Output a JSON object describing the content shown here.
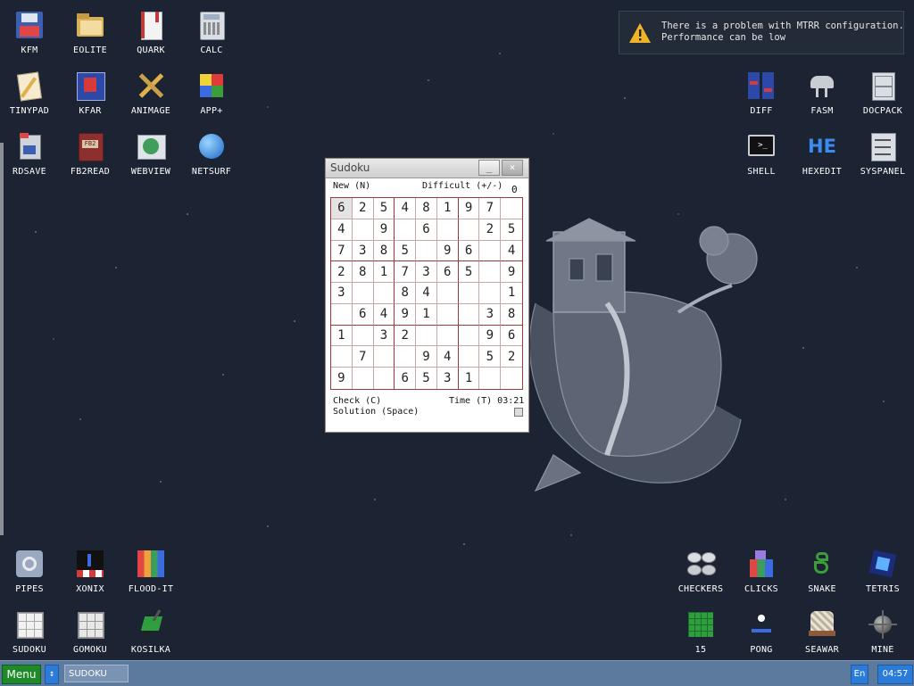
{
  "desktop": {
    "background_color": "#1c2433",
    "icons": [
      {
        "id": "kfm",
        "label": "KFM",
        "icon": "floppy-disk-icon"
      },
      {
        "id": "eolite",
        "label": "EOLITE",
        "icon": "folder-icon"
      },
      {
        "id": "quark",
        "label": "QUARK",
        "icon": "notebook-icon"
      },
      {
        "id": "calc",
        "label": "CALC",
        "icon": "calculator-icon"
      },
      {
        "id": "tinypad",
        "label": "TINYPAD",
        "icon": "notepad-icon"
      },
      {
        "id": "kfar",
        "label": "KFAR",
        "icon": "kfar-icon"
      },
      {
        "id": "animage",
        "label": "ANIMAGE",
        "icon": "pencil-ruler-icon"
      },
      {
        "id": "app-plus",
        "label": "APP+",
        "icon": "rubik-cube-icon"
      },
      {
        "id": "rdsave",
        "label": "RDSAVE",
        "icon": "rdsave-icon"
      },
      {
        "id": "fb2read",
        "label": "FB2READ",
        "icon": "book-icon"
      },
      {
        "id": "webview",
        "label": "WEBVIEW",
        "icon": "webview-icon"
      },
      {
        "id": "netsurf",
        "label": "NETSURF",
        "icon": "globe-icon"
      },
      {
        "id": "diff",
        "label": "DIFF",
        "icon": "diff-icon"
      },
      {
        "id": "fasm",
        "label": "FASM",
        "icon": "fasm-icon"
      },
      {
        "id": "docpack",
        "label": "DOCPACK",
        "icon": "cabinet-icon"
      },
      {
        "id": "shell",
        "label": "SHELL",
        "icon": "terminal-icon"
      },
      {
        "id": "hexedit",
        "label": "HEXEDIT",
        "icon": "hexedit-icon"
      },
      {
        "id": "syspanel",
        "label": "SYSPANEL",
        "icon": "sliders-icon"
      },
      {
        "id": "pipes",
        "label": "PIPES",
        "icon": "pipes-icon"
      },
      {
        "id": "xonix",
        "label": "XONIX",
        "icon": "xonix-icon"
      },
      {
        "id": "flood-it",
        "label": "FLOOD-IT",
        "icon": "colored-grid-icon"
      },
      {
        "id": "sudoku",
        "label": "SUDOKU",
        "icon": "sudoku-icon"
      },
      {
        "id": "gomoku",
        "label": "GOMOKU",
        "icon": "gomoku-icon"
      },
      {
        "id": "kosilka",
        "label": "KOSILKA",
        "icon": "lawnmower-icon"
      },
      {
        "id": "checkers",
        "label": "CHECKERS",
        "icon": "checkers-icon"
      },
      {
        "id": "clicks",
        "label": "CLICKS",
        "icon": "blocks-icon"
      },
      {
        "id": "snake",
        "label": "SNAKE",
        "icon": "snake-icon"
      },
      {
        "id": "tetris",
        "label": "TETRIS",
        "icon": "tetris-icon"
      },
      {
        "id": "fifteen",
        "label": "15",
        "icon": "fifteen-icon"
      },
      {
        "id": "pong",
        "label": "PONG",
        "icon": "pong-icon"
      },
      {
        "id": "seawar",
        "label": "SEAWAR",
        "icon": "ship-icon"
      },
      {
        "id": "mine",
        "label": "MINE",
        "icon": "mine-icon"
      }
    ]
  },
  "notification": {
    "icon": "warning-icon",
    "line1": "There is a problem with MTRR configuration.",
    "line2": "Performance can be low"
  },
  "sudoku_window": {
    "title": "Sudoku",
    "new_label": "New (N)",
    "difficulty_label": "Difficult (+/-)",
    "difficulty_value": "0",
    "check_label": "Check (C)",
    "time_label": "Time (T) 03:21",
    "solution_label": "Solution (Space)",
    "minimize_label": "_",
    "close_label": "×",
    "grid": [
      [
        "6",
        "2",
        "5",
        "4",
        "8",
        "1",
        "9",
        "7",
        ""
      ],
      [
        "4",
        "",
        "9",
        "",
        "6",
        "",
        "",
        "2",
        "5"
      ],
      [
        "7",
        "3",
        "8",
        "5",
        "",
        "9",
        "6",
        "",
        "4"
      ],
      [
        "2",
        "8",
        "1",
        "7",
        "3",
        "6",
        "5",
        "",
        "9"
      ],
      [
        "3",
        "",
        "",
        "8",
        "4",
        "",
        "",
        "",
        "1"
      ],
      [
        "",
        "6",
        "4",
        "9",
        "1",
        "",
        "",
        "3",
        "8"
      ],
      [
        "1",
        "",
        "3",
        "2",
        "",
        "",
        "",
        "9",
        "6"
      ],
      [
        "",
        "7",
        "",
        "",
        "9",
        "4",
        "",
        "5",
        "2"
      ],
      [
        "9",
        "",
        "",
        "6",
        "5",
        "3",
        "1",
        "",
        ""
      ]
    ],
    "selected_cell": [
      0,
      0
    ]
  },
  "taskbar": {
    "menu_label": "Menu",
    "scroll_icon": "updown-arrow-icon",
    "task_label": "SUDOKU",
    "language": "En",
    "clock": "04:57",
    "color": "#5c7a9e",
    "menu_color": "#1f8a2a"
  }
}
